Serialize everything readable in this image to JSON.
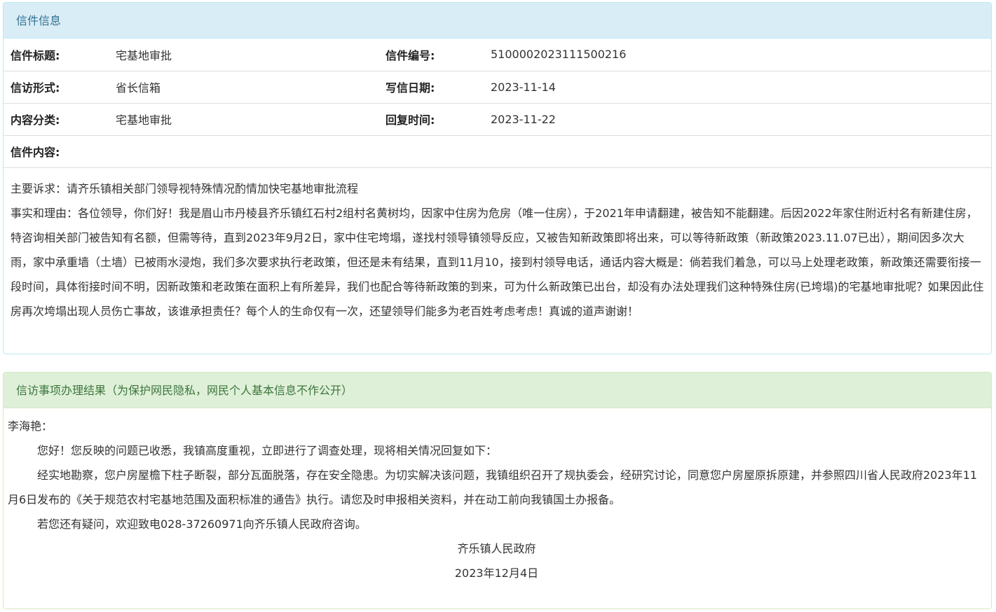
{
  "info_panel": {
    "heading": "信件信息",
    "rows": [
      {
        "label1": "信件标题:",
        "value1": "宅基地审批",
        "label2": "信件编号:",
        "value2": "5100002023111500216"
      },
      {
        "label1": "信访形式:",
        "value1": "省长信箱",
        "label2": "写信日期:",
        "value2": "2023-11-14"
      },
      {
        "label1": "内容分类:",
        "value1": "宅基地审批",
        "label2": "回复时间:",
        "value2": "2023-11-22"
      }
    ],
    "content_label": "信件内容:",
    "content_lines": [
      "主要诉求：请齐乐镇相关部门领导视特殊情况酌情加快宅基地审批流程",
      "事实和理由：各位领导，你们好！我是眉山市丹棱县齐乐镇红石村2组村名黄树均，因家中住房为危房（唯一住房），于2021年申请翻建，被告知不能翻建。后因2022年家住附近村名有新建住房，特咨询相关部门被告知有名额，但需等待，直到2023年9月2日，家中住宅垮塌，遂找村领导镇领导反应，又被告知新政策即将出来，可以等待新政策（新政策2023.11.07已出），期间因多次大雨，家中承重墙（土墙）已被雨水浸炮，我们多次要求执行老政策，但还是未有结果，直到11月10，接到村领导电话，通话内容大概是：倘若我们着急，可以马上处理老政策，新政策还需要衔接一段时间，具体衔接时间不明，因新政策和老政策在面积上有所差异，我们也配合等待新政策的到来，可为什么新政策已出台，却没有办法处理我们这种特殊住房(已垮塌)的宅基地审批呢？如果因此住房再次垮塌出现人员伤亡事故，该谁承担责任？每个人的生命仅有一次，还望领导们能多为老百姓考虑考虑！真诚的道声谢谢！"
    ]
  },
  "result_panel": {
    "heading": "信访事项办理结果（为保护网民隐私，网民个人基本信息不作公开）",
    "salutation": "李海艳：",
    "paragraphs": [
      "您好！您反映的问题已收悉，我镇高度重视，立即进行了调查处理，现将相关情况回复如下：",
      "经实地勘察，您户房屋檐下柱子断裂，部分瓦面脱落，存在安全隐患。为切实解决该问题，我镇组织召开了规执委会，经研究讨论，同意您户房屋原拆原建，并参照四川省人民政府2023年11月6日发布的《关于规范农村宅基地范围及面积标准的通告》执行。请您及时申报相关资料，并在动工前向我镇国土办报备。",
      "若您还有疑问，欢迎致电028-37260971向齐乐镇人民政府咨询。"
    ],
    "signature": "齐乐镇人民政府",
    "date": "2023年12月4日"
  }
}
